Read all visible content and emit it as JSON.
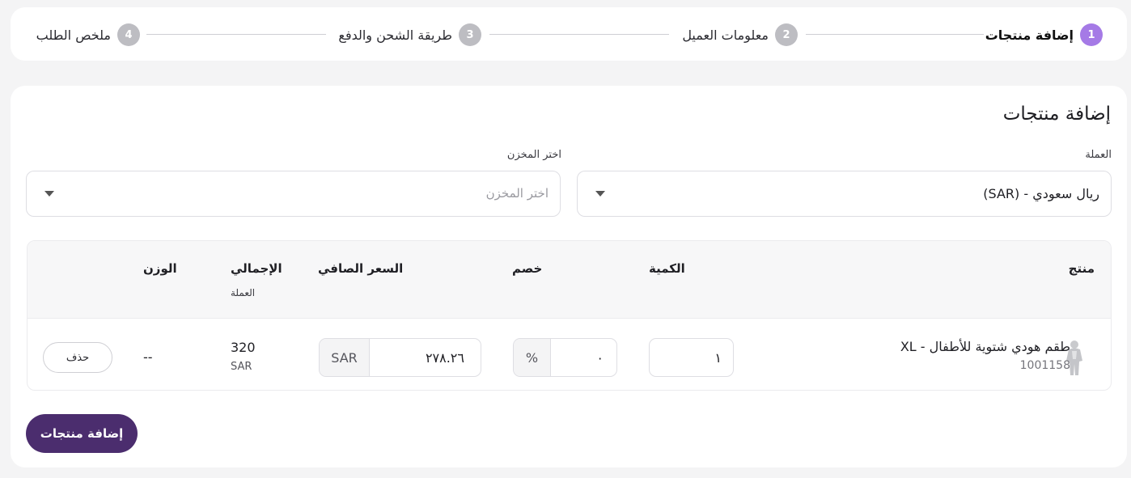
{
  "stepper": {
    "steps": [
      {
        "num": "1",
        "label": "إضافة منتجات"
      },
      {
        "num": "2",
        "label": "معلومات العميل"
      },
      {
        "num": "3",
        "label": "طريقة الشحن والدفع"
      },
      {
        "num": "4",
        "label": "ملخص الطلب"
      }
    ],
    "active_color": "#a57ae6"
  },
  "card": {
    "title": "إضافة منتجات",
    "currency": {
      "label": "العملة",
      "value": "ريال سعودي - (SAR)"
    },
    "warehouse": {
      "label": "اختر المخزن",
      "placeholder": "اختر المخزن"
    }
  },
  "table": {
    "headers": {
      "product": "منتج",
      "quantity": "الكمية",
      "discount": "خصم",
      "net_price": "السعر الصافي",
      "total": "الإجمالي",
      "total_sub": "العملة",
      "weight": "الوزن"
    },
    "rows": [
      {
        "name": "طقم هودي شتوية للأطفال - XL",
        "sku": "1001158",
        "quantity": "١",
        "discount": "٠",
        "discount_unit": "%",
        "net_price": "٢٧٨.٢٦",
        "price_currency": "SAR",
        "total": "320",
        "total_currency": "SAR",
        "weight": "--",
        "delete_label": "حذف"
      }
    ]
  },
  "actions": {
    "add_products_label": "إضافة منتجات",
    "primary_color": "#4b2d6e"
  }
}
